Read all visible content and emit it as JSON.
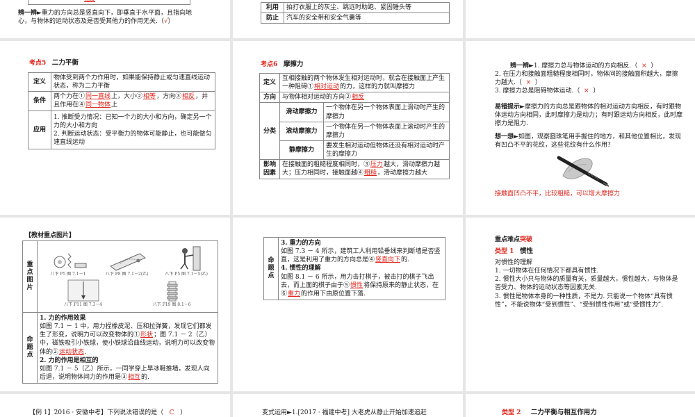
{
  "s1": {
    "answer_top": "相反",
    "prefix": "辨一辨",
    "text": "►重力的方向总是竖直向下，即垂直于水平面，且指向地心，与物体的运动状态及是否受其他力的作用无关.（",
    "mark": "√",
    "close": "）"
  },
  "s2": {
    "rows": [
      {
        "label": "利用",
        "text": "拍打衣服上的灰尘、跳远时助跑、紧固锤头等"
      },
      {
        "label": "防止",
        "text": "汽车的安全带和安全气囊等"
      }
    ]
  },
  "s3": {
    "kaodian": "考点",
    "num": "5",
    "title": "二力平衡",
    "def_label": "定义",
    "def_text": "物体受到两个力作用时，如果能保持静止或匀速直线运动状态，称为二力平衡",
    "cond_label": "条件",
    "cond_p1": "两个力在①",
    "cond_a1": "同一直线",
    "cond_p2": "上，大小②",
    "cond_a2": "相等",
    "cond_p3": "，方向③",
    "cond_a3": "相反",
    "cond_p4": "，并且作用在④",
    "cond_a4": "同一物体",
    "cond_p5": "上",
    "app_label": "应用",
    "app_text1": "1. 推断受力情况：已知一个力的大小和方向，确定另一个力的大小和方向",
    "app_text2": "2. 判断运动状态：受平衡力的物体可能静止，也可能做匀速直线运动"
  },
  "s4": {
    "kaodian": "考点",
    "num": "6",
    "title": "摩擦力",
    "def_label": "定义",
    "def_p1": "互相接触的两个物体发生相对运动时，就会在接触面上产生一种阻碍①",
    "def_a1": "相对运动",
    "def_p2": "的力，这样的力就叫摩擦力",
    "dir_label": "方向",
    "dir_p1": "与物体相对运动的方向②",
    "dir_a1": "相反",
    "cls_label": "分类",
    "cls": [
      {
        "name": "滑动摩擦力",
        "text": "一个物体在另一个物体表面上滑动时产生的摩擦力"
      },
      {
        "name": "滚动摩擦力",
        "text": "一个物体在另一个物体表面上滚动时产生的摩擦力"
      },
      {
        "name": "静摩擦力",
        "text": "要发生相对运动但物体还没有相对运动时产生的摩擦力"
      }
    ],
    "fac_label": "影响因素",
    "fac_p1": "在接触面的粗糙程度相同时，③",
    "fac_a1": "压力",
    "fac_p2": "越大，滑动摩擦力越大；压力相同时，接触面越④",
    "fac_a2": "粗糙",
    "fac_p3": "，滑动摩擦力越大"
  },
  "s5": {
    "bianyibian": "辨一辨",
    "items": [
      {
        "text": "►1. 摩擦力总与物体运动的方向相反.（",
        "mark": "×",
        "close": "）"
      },
      {
        "text": "2. 在压力和接触面粗糙程度相同时，物体间的接触面积越大，摩擦力越大.（",
        "mark": "×",
        "close": "）"
      },
      {
        "text": "3. 摩擦力总是阻碍物体运动.（",
        "mark": "×",
        "close": "）"
      }
    ],
    "yicuo_label": "易错提示",
    "yicuo_text": "►摩擦力的方向总是跟物体的相对运动方向相反，有时跟物体运动方向相同，此时摩擦力是动力；有时跟运动方向相反，此时摩擦力是阻力.",
    "xiang_label": "想一想",
    "xiang_text": "►如图，观察圆珠笔用手握住的地方，和其他位置相比，发现有凹凸不平的花纹，这些花纹有什么作用？",
    "answer": "接触面凹凸不平，比较粗糙，可以增大摩擦力"
  },
  "s6": {
    "header": "【教材重点图片】",
    "col1_label": "重点图片",
    "figs": [
      "八下 P5 图 7.1－1",
      "八下 P8 图 7.1－2(乙)",
      "八下 P5 图 7.1－5(乙)",
      "八下 P11 图 7.3－4",
      "八下 P19 图 8.1－6"
    ],
    "col2_label": "命题点",
    "h1": "1. 力的作用效果",
    "p1_a": "如图 7.1 － 1 中，用力捏橡皮泥、压和拉弹簧，发现它们都发生了形变，说明力可以改变物体的①",
    "p1_b1": "形状",
    "p1_c": "；图 7.1 － 2（乙）中，磁铁吸引小铁球，使小铁球沿曲线运动，说明力可以改变物体的②",
    "p1_b2": "运动状态",
    "p1_d": ".",
    "h2": "2. 力的作用是相互的",
    "p2_a": "如图 7.1 － 5（乙）所示，一同学穿上旱冰鞋推墙，发现人向后退，说明物体间力的作用是③",
    "p2_b": "相互",
    "p2_c": "的."
  },
  "s7": {
    "label": "命题点",
    "h3": "3. 重力的方向",
    "p3_a": "如图 7.3 － 4 所示，建筑工人利用铅垂线来判断墙是否竖直，这是利用了重力的方向总是④",
    "p3_b": "竖直向下",
    "p3_c": "的.",
    "h4": "4. 惯性的理解",
    "p4_a": "如图 8.1 － 6 所示，用力击打棋子，被击打的棋子飞出去，而上面的棋子由于⑤",
    "p4_b": "惯性",
    "p4_c": "将保持原来的静止状态，在⑥",
    "p4_d": "重力",
    "p4_e": "的作用下由原位置下落."
  },
  "s8": {
    "title_a": "重点难点",
    "title_b": "突破",
    "type_label": "类型 1",
    "type_name": "惯性",
    "sub": "对惯性的理解",
    "lines": [
      "1. 一切物体在任何情况下都具有惯性.",
      "2. 惯性大小只与物体的质量有关，质量越大，惯性越大，与物体是否受力、物体的运动状态等因素无关.",
      "3. 惯性是物体本身的一种性质，不是力. 只能说一个物体“具有惯性”，不能说物体“受到惯性”、“受到惯性作用”或“受惯性力”."
    ]
  },
  "s9": {
    "text_a": "【例 1】2016 · 安徽中考】下列说法错误的是（",
    "ans": "C",
    "text_b": "）"
  },
  "s10": {
    "text": "变式运用►1.[2017 · 福建中考] 大老虎从静止开始加速追赶"
  },
  "s11": {
    "type_label": "类型 2",
    "type_name": "二力平衡与相互作用力"
  }
}
